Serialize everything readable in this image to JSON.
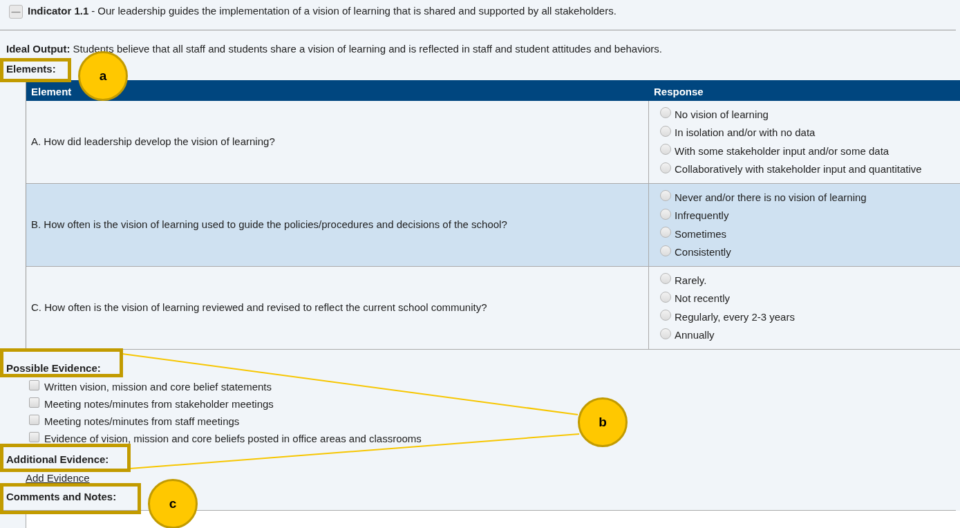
{
  "indicator": {
    "collapse_icon": "—",
    "label": "Indicator 1.1",
    "separator": "-",
    "text": "Our leadership guides the implementation of a vision of learning that is shared and supported by all stakeholders."
  },
  "ideal_output": {
    "label": "Ideal Output:",
    "text": "Students believe that all staff and students share a vision of learning and is reflected in staff and student attitudes and behaviors."
  },
  "elements": {
    "heading": "Elements:",
    "table": {
      "columns": [
        "Element",
        "Response"
      ],
      "rows": [
        {
          "question": "A. How did leadership develop the vision of learning?",
          "highlighted": false,
          "options": [
            {
              "label": "No vision of learning",
              "selected": false
            },
            {
              "label": "In isolation and/or with no data",
              "selected": false
            },
            {
              "label": "With some stakeholder input and/or some data",
              "selected": false
            },
            {
              "label": "Collaboratively with stakeholder input and quantitative",
              "selected": false
            }
          ]
        },
        {
          "question": "B. How often is the vision of learning used to guide the policies/procedures and decisions of the school?",
          "highlighted": true,
          "options": [
            {
              "label": "Never and/or there is no vision of learning",
              "selected": false
            },
            {
              "label": "Infrequently",
              "selected": false
            },
            {
              "label": "Sometimes",
              "selected": false
            },
            {
              "label": "Consistently",
              "selected": false
            }
          ]
        },
        {
          "question": "C. How often is the vision of learning reviewed and revised to reflect the current school community?",
          "highlighted": false,
          "options": [
            {
              "label": "Rarely.",
              "selected": false
            },
            {
              "label": "Not recently",
              "selected": false
            },
            {
              "label": "Regularly, every 2-3 years",
              "selected": false
            },
            {
              "label": "Annually",
              "selected": false
            }
          ]
        }
      ]
    }
  },
  "possible_evidence": {
    "heading": "Possible Evidence:",
    "items": [
      {
        "label": "Written vision, mission and core belief statements",
        "checked": false
      },
      {
        "label": "Meeting notes/minutes from stakeholder meetings",
        "checked": false
      },
      {
        "label": "Meeting notes/minutes from staff meetings",
        "checked": false
      },
      {
        "label": "Evidence of vision, mission and core beliefs posted in office areas and classrooms",
        "checked": false
      }
    ]
  },
  "additional_evidence": {
    "heading": "Additional Evidence:",
    "link": "Add Evidence"
  },
  "comments": {
    "heading": "Comments and Notes:"
  },
  "callouts": [
    {
      "label": "a"
    },
    {
      "label": "b"
    },
    {
      "label": "c"
    }
  ]
}
